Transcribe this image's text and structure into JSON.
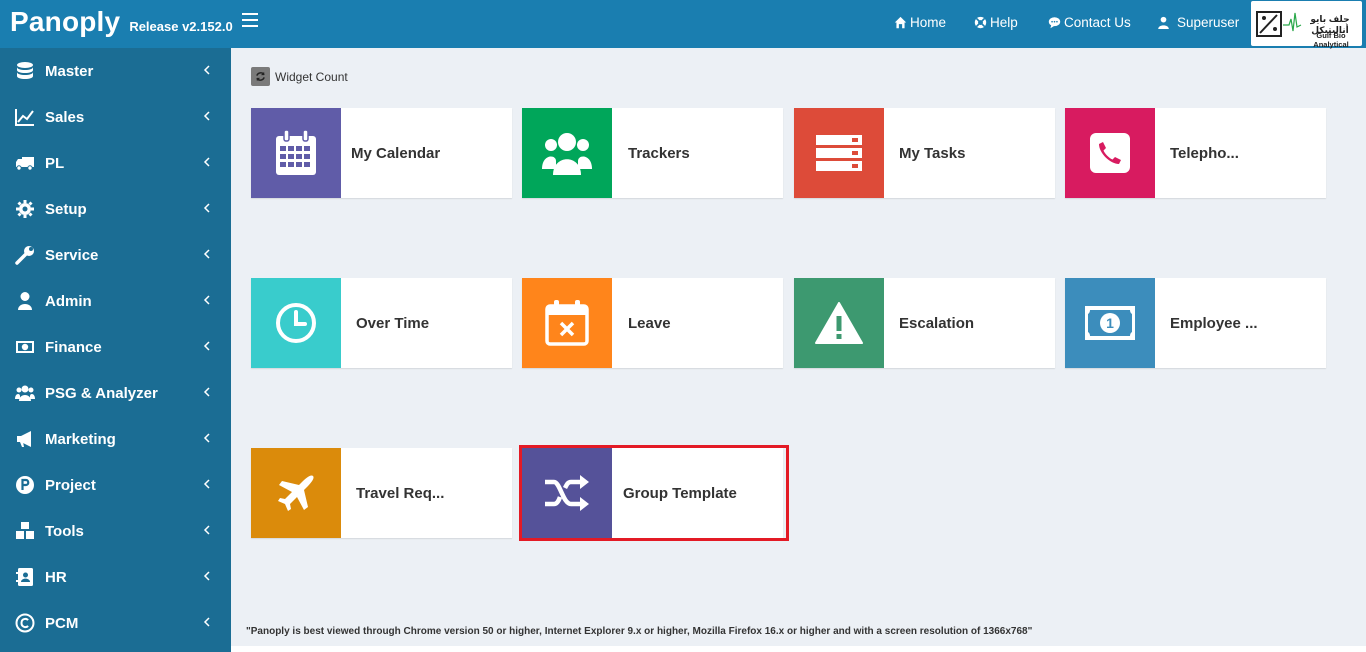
{
  "header": {
    "brand": "Panoply",
    "release": "Release v2.152.0",
    "nav": {
      "home": "Home",
      "help": "Help",
      "contact": "Contact Us",
      "user": "Superuser"
    },
    "logo": {
      "arabic": "جلف بايو أناليتيكل",
      "english": "Gulf Bio Analytical"
    }
  },
  "sidebar": {
    "items": [
      {
        "label": "Master",
        "icon": "database-icon"
      },
      {
        "label": "Sales",
        "icon": "line-chart-icon"
      },
      {
        "label": "PL",
        "icon": "truck-icon"
      },
      {
        "label": "Setup",
        "icon": "gear-icon"
      },
      {
        "label": "Service",
        "icon": "wrench-icon"
      },
      {
        "label": "Admin",
        "icon": "user-icon"
      },
      {
        "label": "Finance",
        "icon": "money-icon"
      },
      {
        "label": "PSG & Analyzer",
        "icon": "users-icon"
      },
      {
        "label": "Marketing",
        "icon": "bullhorn-icon"
      },
      {
        "label": "Project",
        "icon": "p-circle-icon"
      },
      {
        "label": "Tools",
        "icon": "cubes-icon"
      },
      {
        "label": "HR",
        "icon": "contact-card-icon"
      },
      {
        "label": "PCM",
        "icon": "copyright-icon"
      }
    ]
  },
  "content": {
    "widget_count_label": "Widget Count",
    "tiles": [
      {
        "label": "My Calendar",
        "color": "#605ca8",
        "icon": "calendar-icon"
      },
      {
        "label": "Trackers",
        "color": "#00a65a",
        "icon": "users-icon"
      },
      {
        "label": "My Tasks",
        "color": "#dd4b39",
        "icon": "server-icon"
      },
      {
        "label": "Telepho...",
        "color": "#d81b60",
        "icon": "phone-icon"
      },
      {
        "label": "Over Time",
        "color": "#39cccc",
        "icon": "clock-icon"
      },
      {
        "label": "Leave",
        "color": "#ff851b",
        "icon": "calendar-x-icon"
      },
      {
        "label": "Escalation",
        "color": "#3d9970",
        "icon": "warning-icon"
      },
      {
        "label": "Employee ...",
        "color": "#3c8dbc",
        "icon": "money-icon"
      },
      {
        "label": "Travel Req...",
        "color": "#db8b0b",
        "icon": "plane-icon"
      },
      {
        "label": "Group Template",
        "color": "#555299",
        "icon": "shuffle-icon"
      }
    ],
    "footer_note": "\"Panoply is best viewed through Chrome version 50 or higher, Internet Explorer 9.x or higher, Mozilla Firefox 16.x or higher and with a screen resolution of 1366x768\""
  }
}
